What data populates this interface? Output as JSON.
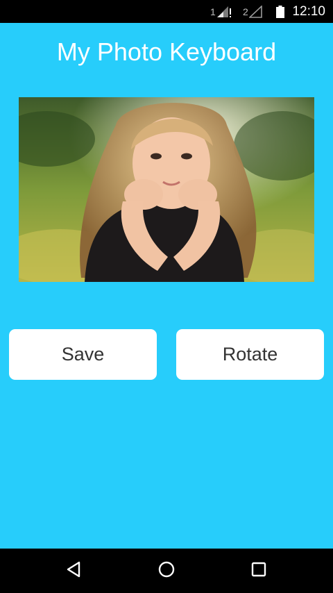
{
  "status_bar": {
    "sim1_label": "1",
    "sim2_label": "2",
    "time": "12:10",
    "signal1_icon": "signal-no-data-icon",
    "signal2_icon": "signal-empty-icon",
    "battery_icon": "battery-full-icon"
  },
  "app": {
    "title": "My Photo Keyboard",
    "background_color": "#27cdfb"
  },
  "photo": {
    "description_icon": "photo-image"
  },
  "buttons": {
    "save_label": "Save",
    "rotate_label": "Rotate"
  },
  "nav_bar": {
    "back_icon": "back-triangle-icon",
    "home_icon": "home-circle-icon",
    "recents_icon": "recents-square-icon"
  }
}
